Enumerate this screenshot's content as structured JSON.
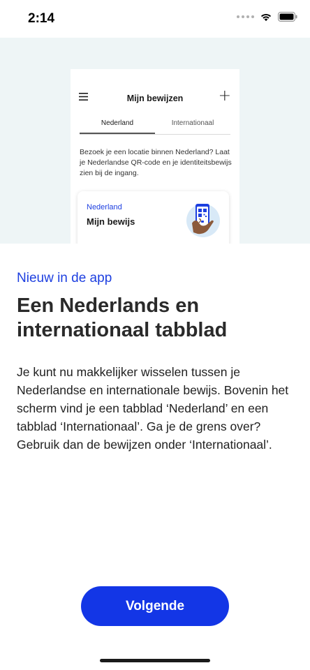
{
  "status_bar": {
    "time": "2:14",
    "icons": [
      "signal-dots-icon",
      "wifi-icon",
      "battery-icon"
    ]
  },
  "preview": {
    "header_title": "Mijn bewijzen",
    "menu_icon": "hamburger-menu-icon",
    "add_icon": "plus-icon",
    "plus_glyph": "+",
    "tabs": [
      {
        "label": "Nederland",
        "active": true
      },
      {
        "label": "Internationaal",
        "active": false
      }
    ],
    "intro_text": "Bezoek je een locatie binnen Nederland? Laat je Nederlandse QR-code en je identiteitsbewijs zien bij de ingang.",
    "card": {
      "label": "Nederland",
      "title": "Mijn bewijs",
      "illustration": "hand-holding-phone-qr-icon"
    }
  },
  "content": {
    "eyebrow": "Nieuw in de app",
    "headline": "Een Nederlands en internationaal tabblad",
    "body": "Je kunt nu makkelijker wisselen tussen je Nederlandse en internationale bewijs. Bovenin het scherm vind je een tabblad ‘Nederland’ en een tabblad ‘Internationaal’. Ga je de grens over? Gebruik dan de bewijzen onder ‘Internationaal’."
  },
  "actions": {
    "next_label": "Volgende"
  },
  "colors": {
    "accent": "#1336e6",
    "eyebrow": "#1d3fe0",
    "hero_background": "#eef5f6"
  }
}
